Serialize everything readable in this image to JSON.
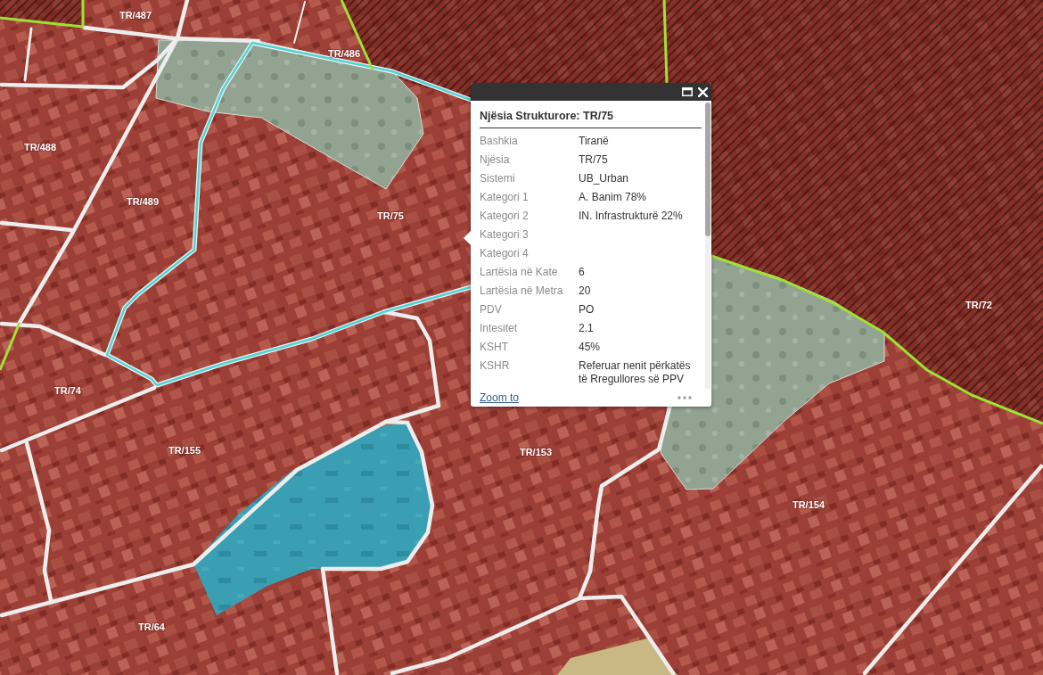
{
  "map": {
    "zone_labels": [
      "TR/487",
      "TR/486",
      "TR/488",
      "TR/489",
      "TR/75",
      "TR/72",
      "TR/74",
      "TR/155",
      "TR/153",
      "TR/154",
      "TR/64"
    ]
  },
  "popup": {
    "title": "Njësia Strukturore: TR/75",
    "fields": [
      {
        "label": "Bashkia",
        "value": "Tiranë"
      },
      {
        "label": "Njësia",
        "value": "TR/75"
      },
      {
        "label": "Sistemi",
        "value": "UB_Urban"
      },
      {
        "label": "Kategori 1",
        "value": "A. Banim 78%"
      },
      {
        "label": "Kategori 2",
        "value": "IN. Infrastrukturë 22%"
      },
      {
        "label": "Kategori 3"
      },
      {
        "label": "Kategori 4"
      },
      {
        "label": "Lartësia në Kate",
        "value": "6"
      },
      {
        "label": "Lartësia në Metra",
        "value": "20"
      },
      {
        "label": "PDV",
        "value": "PO"
      },
      {
        "label": "Intesitet",
        "value": "2.1"
      },
      {
        "label": "KSHT",
        "value": "45%"
      },
      {
        "label": "KSHR",
        "value": "Referuar nenit përkatës të Rregullores së PPV"
      }
    ],
    "link": "Zoom to"
  }
}
